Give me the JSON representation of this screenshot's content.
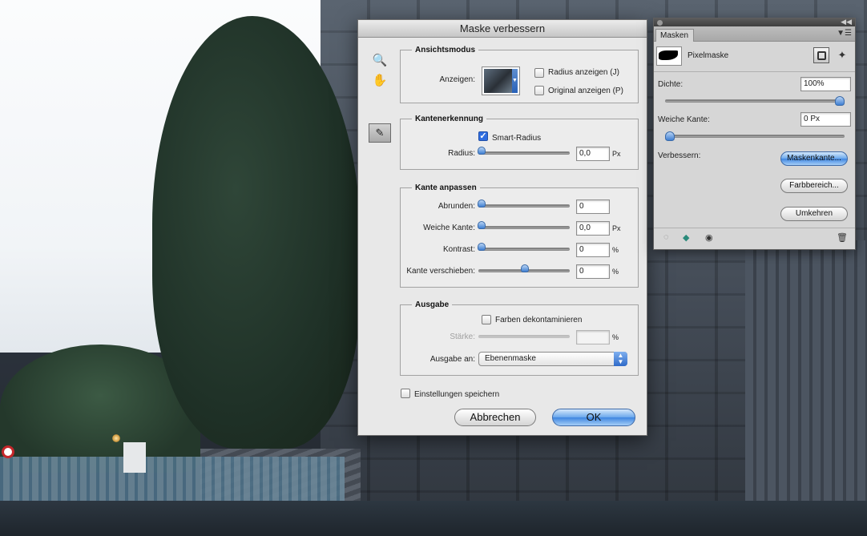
{
  "dialog": {
    "title": "Maske verbessern",
    "view_mode": {
      "legend": "Ansichtsmodus",
      "show_label": "Anzeigen:",
      "show_radius": {
        "label": "Radius anzeigen (J)",
        "checked": false
      },
      "show_original": {
        "label": "Original anzeigen (P)",
        "checked": false
      }
    },
    "edge_detection": {
      "legend": "Kantenerkennung",
      "smart_radius": {
        "label": "Smart-Radius",
        "checked": true
      },
      "radius_label": "Radius:",
      "radius_value": "0,0",
      "radius_unit": "Px"
    },
    "adjust_edge": {
      "legend": "Kante anpassen",
      "smooth": {
        "label": "Abrunden:",
        "value": "0",
        "unit": ""
      },
      "feather": {
        "label": "Weiche Kante:",
        "value": "0,0",
        "unit": "Px"
      },
      "contrast": {
        "label": "Kontrast:",
        "value": "0",
        "unit": "%"
      },
      "shift_edge": {
        "label": "Kante verschieben:",
        "value": "0",
        "unit": "%"
      }
    },
    "output": {
      "legend": "Ausgabe",
      "decontaminate": {
        "label": "Farben dekontaminieren",
        "checked": false
      },
      "amount_label": "Stärke:",
      "amount_value": "",
      "amount_unit": "%",
      "output_to_label": "Ausgabe an:",
      "output_to_value": "Ebenenmaske"
    },
    "remember_settings": {
      "label": "Einstellungen speichern",
      "checked": false
    },
    "cancel_label": "Abbrechen",
    "ok_label": "OK"
  },
  "masks_panel": {
    "tab": "Masken",
    "mask_type": "Pixelmaske",
    "density_label": "Dichte:",
    "density_value": "100%",
    "density_level": 1.0,
    "feather_label": "Weiche Kante:",
    "feather_value": "0 Px",
    "feather_level": 0.0,
    "refine_label": "Verbessern:",
    "mask_edge_button": "Maskenkante...",
    "color_range_button": "Farbbereich...",
    "invert_button": "Umkehren"
  },
  "colors": {
    "accent_blue": "#3f86e0",
    "dialog_bg": "#e8e8e8",
    "panel_bg": "#d6d6d6"
  },
  "icons": [
    "zoom-icon",
    "hand-icon",
    "refine-radius-brush-icon",
    "mask-from-selection-icon",
    "apply-mask-icon",
    "visibility-eye-icon",
    "trash-icon",
    "pixel-mask-icon",
    "vector-mask-icon",
    "panel-menu-icon"
  ]
}
